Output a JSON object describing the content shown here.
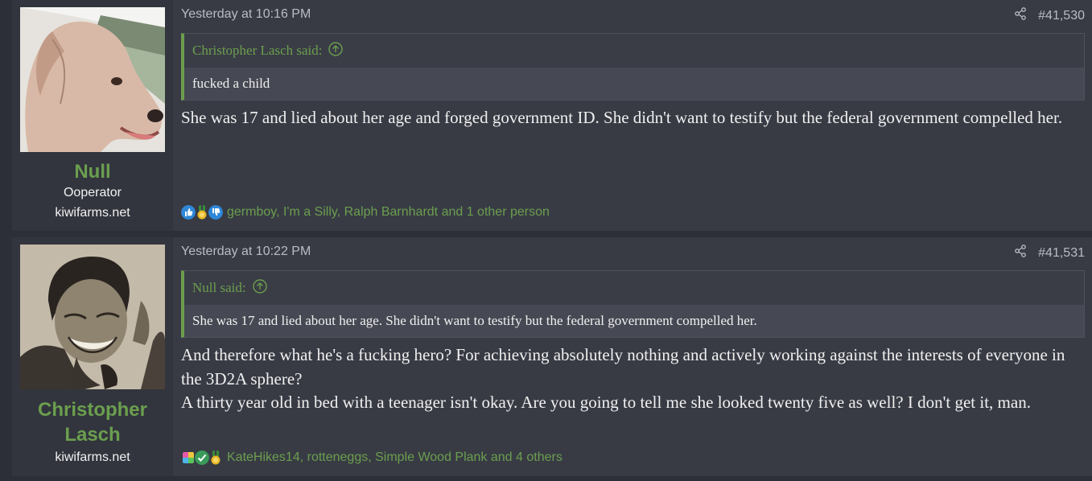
{
  "posts": [
    {
      "user": {
        "name": "Null",
        "title": "Ooperator",
        "site": "kiwifarms.net"
      },
      "date": "Yesterday at 10:16 PM",
      "post_number": "#41,530",
      "quote": {
        "author": "Christopher Lasch said:",
        "text": "fucked a child"
      },
      "body": [
        "She was 17 and lied about her age and forged government ID. She didn't want to testify but the federal government compelled her."
      ],
      "reactions": {
        "icons": [
          "thumbs-up-icon",
          "medal-icon",
          "thumbs-down-icon"
        ],
        "text": "germboy, I'm a Silly, Ralph Barnhardt and 1 other person"
      }
    },
    {
      "user": {
        "name": "Christopher Lasch",
        "title": "",
        "site": "kiwifarms.net"
      },
      "date": "Yesterday at 10:22 PM",
      "post_number": "#41,531",
      "quote": {
        "author": "Null said:",
        "text": "She was 17 and lied about her age. She didn't want to testify but the federal government compelled her."
      },
      "body": [
        "And therefore what he's a fucking hero? For achieving absolutely nothing and actively working against the interests of everyone in the 3D2A sphere?",
        "A thirty year old in bed with a teenager isn't okay. Are you going to tell me she looked twenty five as well? I don't get it, man."
      ],
      "reactions": {
        "icons": [
          "puzzle-icon",
          "checkmark-icon",
          "medal-icon"
        ],
        "text": "KateHikes14, rotteneggs, Simple Wood Plank and 4 others"
      }
    }
  ],
  "colors": {
    "accent": "#6b9e4e",
    "post_bg": "#383b44",
    "user_bg": "#32353d"
  }
}
